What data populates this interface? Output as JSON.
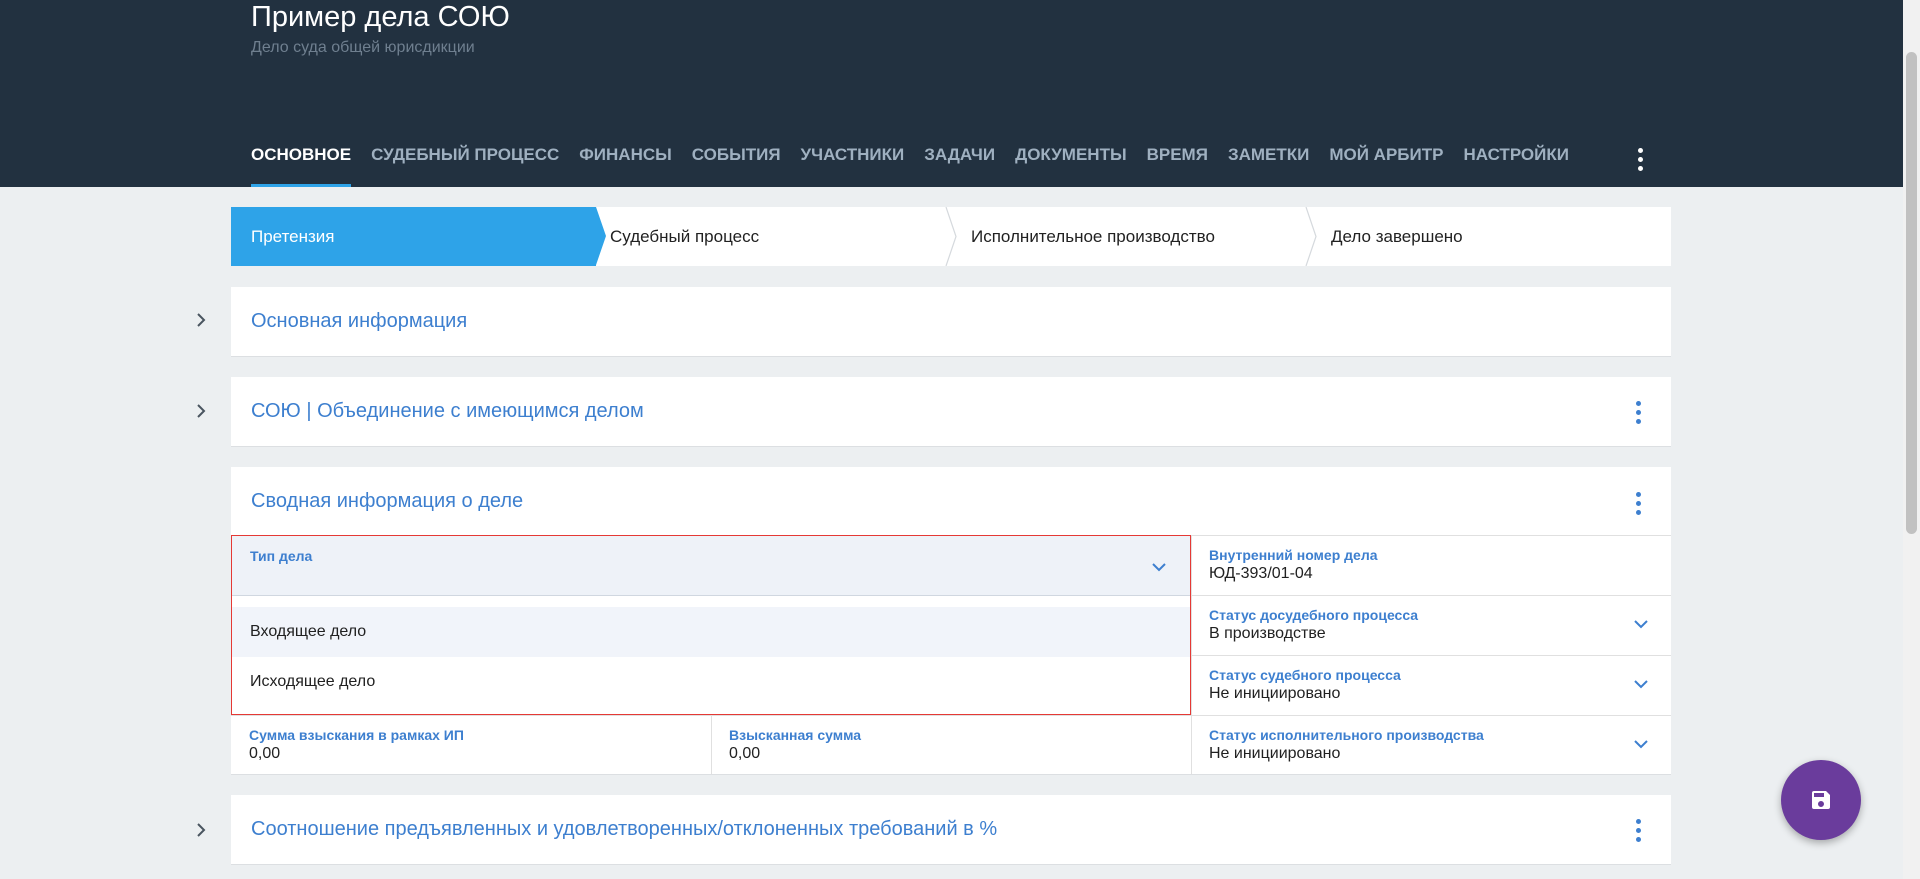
{
  "header": {
    "title": "Пример дела СОЮ",
    "subtitle": "Дело суда общей юрисдикции",
    "tabs": [
      {
        "label": "ОСНОВНОЕ",
        "active": true
      },
      {
        "label": "СУДЕБНЫЙ ПРОЦЕСС"
      },
      {
        "label": "ФИНАНСЫ"
      },
      {
        "label": "СОБЫТИЯ"
      },
      {
        "label": "УЧАСТНИКИ"
      },
      {
        "label": "ЗАДАЧИ"
      },
      {
        "label": "ДОКУМЕНТЫ"
      },
      {
        "label": "ВРЕМЯ"
      },
      {
        "label": "ЗАМЕТКИ"
      },
      {
        "label": "МОЙ АРБИТР"
      },
      {
        "label": "НАСТРОЙКИ"
      }
    ],
    "more_icon": "more-vert-icon"
  },
  "stepper": {
    "steps": [
      {
        "label": "Претензия",
        "active": true
      },
      {
        "label": "Судебный процесс"
      },
      {
        "label": "Исполнительное производство"
      },
      {
        "label": "Дело завершено"
      }
    ]
  },
  "sections": {
    "main_info": {
      "title": "Основная информация"
    },
    "merge": {
      "title": "СОЮ | Объединение с имеющимся делом"
    },
    "summary": {
      "title": "Сводная информация о деле"
    },
    "ratio": {
      "title": "Соотношение предъявленных и удовлетворенных/отклоненных требований в %"
    }
  },
  "summary_fields": {
    "case_type": {
      "label": "Тип дела",
      "value": ""
    },
    "internal_number": {
      "label": "Внутренний номер дела",
      "value": "ЮД-393/01-04"
    },
    "pretrial_status": {
      "label": "Статус досудебного процесса",
      "value": "В производстве"
    },
    "court_status": {
      "label": "Статус судебного процесса",
      "value": "Не инициировано"
    },
    "recovery_amount": {
      "label": "Сумма взыскания в рамках ИП",
      "value": "0,00"
    },
    "recovered_amount": {
      "label": "Взысканная сумма",
      "value": "0,00"
    },
    "enforcement_status": {
      "label": "Статус исполнительного производства",
      "value": "Не инициировано"
    }
  },
  "case_type_dropdown": {
    "options": [
      "Входящее дело",
      "Исходящее дело"
    ]
  },
  "fab": {
    "icon": "save-icon"
  },
  "colors": {
    "header_bg": "#223140",
    "accent": "#2ea3e8",
    "link": "#3d7fcf",
    "fab": "#6a3c9c",
    "focus_border": "#e53935"
  }
}
